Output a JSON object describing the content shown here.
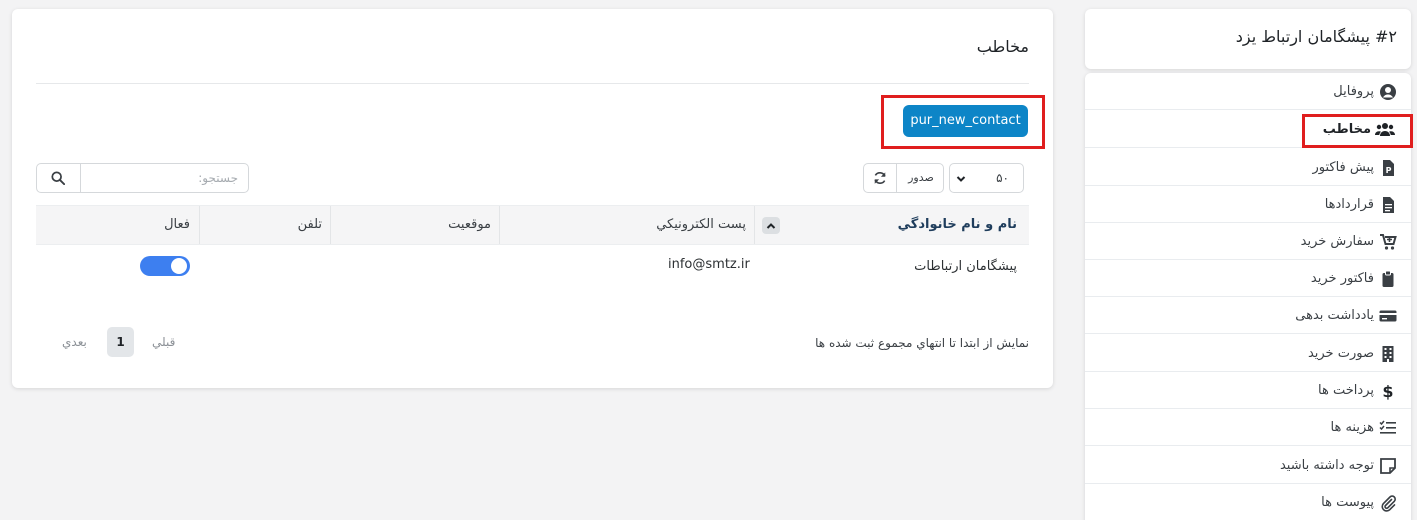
{
  "sidebar": {
    "title": "#۲ پیشگامان ارتباط یزد",
    "items": [
      {
        "label": "پروفایل",
        "icon": "user-circle-icon"
      },
      {
        "label": "مخاطب",
        "icon": "users-icon"
      },
      {
        "label": "پیش فاکتور",
        "icon": "file-p-icon"
      },
      {
        "label": "قراردادها",
        "icon": "file-text-icon"
      },
      {
        "label": "سفارش خرید",
        "icon": "cart-plus-icon"
      },
      {
        "label": "فاکتور خرید",
        "icon": "clipboard-icon"
      },
      {
        "label": "يادداشت بدهی",
        "icon": "credit-card-icon"
      },
      {
        "label": "صورت خرید",
        "icon": "building-icon"
      },
      {
        "label": "پرداخت ها",
        "icon": "dollar-icon"
      },
      {
        "label": "هزینه ها",
        "icon": "list-check-icon"
      },
      {
        "label": "توجه داشته باشید",
        "icon": "note-icon"
      },
      {
        "label": "پیوست ها",
        "icon": "paperclip-icon"
      }
    ]
  },
  "main": {
    "title": "مخاطب",
    "new_button": "pur_new_contact",
    "search_placeholder": "جستجو:",
    "export_label": "صدور",
    "page_size": "۵۰",
    "columns": {
      "name": "نام و نام خانوادگي",
      "email": "پست الکترونيکي",
      "position": "موقعيت",
      "phone": "تلفن",
      "active": "فعال"
    },
    "rows": [
      {
        "name": "پیشگامان ارتباطات",
        "email": "info@smtz.ir",
        "position": "",
        "phone": "",
        "active": true
      }
    ],
    "footer_text": "نمايش از ابتدا تا انتهاي مجموع ثبت شده ها",
    "pagination": {
      "prev": "قبلي",
      "current": "1",
      "next": "بعدي"
    }
  },
  "colors": {
    "primary_button": "#0d85c7",
    "highlight": "#e01e1e",
    "toggle_on": "#3d7ff0"
  }
}
